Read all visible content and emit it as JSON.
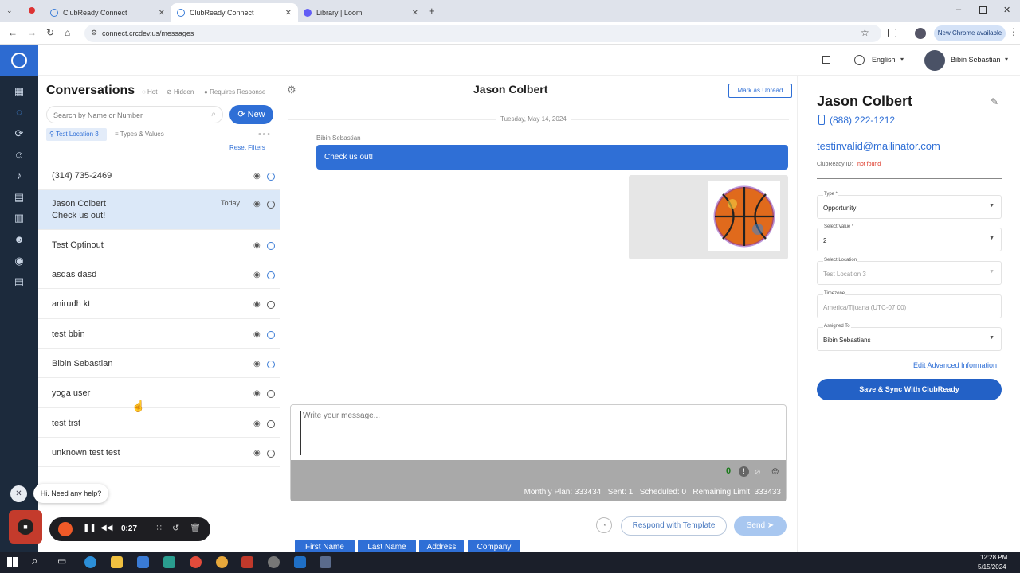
{
  "browser": {
    "tabs": [
      {
        "label": "ClubReady Connect"
      },
      {
        "label": "ClubReady Connect"
      },
      {
        "label": "Library | Loom"
      }
    ],
    "url": "connect.crcdev.us/messages",
    "new_chrome_label": "New Chrome available"
  },
  "header": {
    "language": "English",
    "user_name": "Bibin Sebastian"
  },
  "conversations": {
    "title": "Conversations",
    "legend": {
      "hot": "Hot",
      "hidden": "Hidden",
      "requires_response": "Requires Response"
    },
    "search_placeholder": "Search by Name or Number",
    "new_label": "New",
    "location_filter": "Test Location 3",
    "types_filter": "Types & Values",
    "reset_filters": "Reset Filters",
    "items": [
      {
        "name": "(314) 735-2469",
        "preview": "",
        "time": "",
        "hot": true
      },
      {
        "name": "Jason Colbert",
        "preview": "Check us out!",
        "time": "Today",
        "hot": false
      },
      {
        "name": "Test Optinout",
        "preview": "",
        "time": "",
        "hot": true
      },
      {
        "name": "asdas dasd",
        "preview": "",
        "time": "",
        "hot": true
      },
      {
        "name": "anirudh kt",
        "preview": "",
        "time": "",
        "hot": false
      },
      {
        "name": "test bbin",
        "preview": "",
        "time": "",
        "hot": true
      },
      {
        "name": "Bibin Sebastian",
        "preview": "",
        "time": "",
        "hot": true
      },
      {
        "name": "yoga user",
        "preview": "",
        "time": "",
        "hot": false
      },
      {
        "name": "test trst",
        "preview": "",
        "time": "",
        "hot": false
      },
      {
        "name": "unknown test test",
        "preview": "",
        "time": "",
        "hot": false
      }
    ]
  },
  "chat": {
    "contact_name": "Jason Colbert",
    "mark_unread": "Mark as Unread",
    "date": "Tuesday, May 14, 2024",
    "sender": "Bibin Sebastian",
    "message": "Check us out!",
    "placeholder": "Write your message...",
    "chips": [
      "First Name",
      "Last Name",
      "Address",
      "Company"
    ],
    "char_count": "0",
    "stats": "Monthly Plan: 333434   Sent: 1   Scheduled: 0   Remaining Limit: 333433",
    "respond_template": "Respond with Template",
    "send": "Send"
  },
  "detail": {
    "name": "Jason Colbert",
    "phone": "(888) 222-1212",
    "email": "testinvalid@mailinator.com",
    "clubready_label": "ClubReady ID:",
    "clubready_value": "not found",
    "fields": [
      {
        "label": "Type *",
        "value": "Opportunity",
        "disabled": false,
        "dropdown": true
      },
      {
        "label": "Select Value *",
        "value": "2",
        "disabled": false,
        "dropdown": true
      },
      {
        "label": "Select Location",
        "value": "Test Location 3",
        "disabled": true,
        "dropdown": true
      },
      {
        "label": "Timezone",
        "value": "America/Tijuana (UTC-07:00)",
        "disabled": true,
        "dropdown": false
      },
      {
        "label": "Assigned To",
        "value": "Bibin Sebastians",
        "disabled": false,
        "dropdown": true
      }
    ],
    "edit_advanced": "Edit Advanced Information",
    "save_sync": "Save & Sync With ClubReady"
  },
  "loom": {
    "help_text": "Hi. Need any help?",
    "timer": "0:27"
  },
  "taskbar": {
    "time": "12:28 PM",
    "date": "5/15/2024"
  },
  "colors": {
    "accent": "#2f6fd6",
    "sidebar": "#1c2a3c",
    "selected_row": "#dbe8f8"
  }
}
